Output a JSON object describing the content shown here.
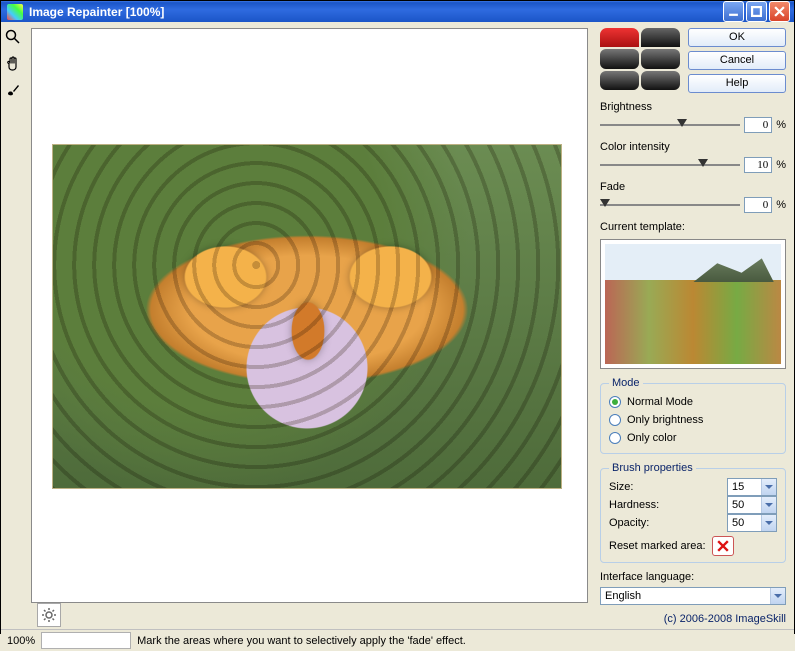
{
  "title": "Image Repainter [100%]",
  "buttons": {
    "ok": "OK",
    "cancel": "Cancel",
    "help": "Help"
  },
  "sliders": {
    "brightness": {
      "label": "Brightness",
      "value": "0",
      "pos": 55
    },
    "color_intensity": {
      "label": "Color intensity",
      "value": "10",
      "pos": 70
    },
    "fade": {
      "label": "Fade",
      "value": "0",
      "pos": 0
    }
  },
  "template_label": "Current template:",
  "mode": {
    "legend": "Mode",
    "normal": "Normal Mode",
    "brightness": "Only brightness",
    "color": "Only color",
    "selected": "normal"
  },
  "brush": {
    "legend": "Brush properties",
    "size_label": "Size:",
    "size": "15",
    "hardness_label": "Hardness:",
    "hardness": "50",
    "opacity_label": "Opacity:",
    "opacity": "50",
    "reset_label": "Reset marked area:"
  },
  "lang_label": "Interface language:",
  "lang_value": "English",
  "copyright": "(c) 2006-2008 ImageSkill",
  "status": {
    "zoom": "100%",
    "hint": "Mark the areas where you want to selectively apply the 'fade' effect."
  }
}
